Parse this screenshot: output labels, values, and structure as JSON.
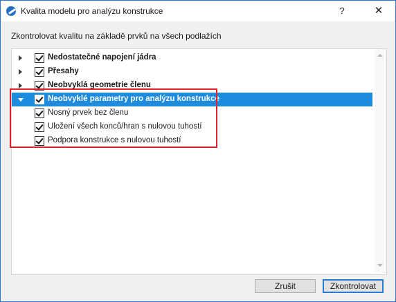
{
  "window": {
    "title": "Kvalita modelu pro analýzu konstrukce",
    "help_label": "?",
    "close_label": "✕"
  },
  "subtitle": "Zkontrolovat kvalitu na základě prvků na všech podlažích",
  "tree": {
    "items": [
      {
        "label": "Nedostatečné napojení jádra",
        "checked": true,
        "expanded": false,
        "bold": true
      },
      {
        "label": "Přesahy",
        "checked": true,
        "expanded": false,
        "bold": true
      },
      {
        "label": "Neobvyklá geometrie členu",
        "checked": true,
        "expanded": false,
        "bold": true
      },
      {
        "label": "Neobvyklé parametry pro analýzu konstrukce",
        "checked": true,
        "expanded": true,
        "bold": true,
        "selected": true
      },
      {
        "label": "Nosný prvek bez členu",
        "checked": true,
        "bold": false
      },
      {
        "label": "Uložení všech konců/hran s nulovou tuhostí",
        "checked": true,
        "bold": false
      },
      {
        "label": "Podpora konstrukce s nulovou tuhostí",
        "checked": true,
        "bold": false
      }
    ]
  },
  "buttons": {
    "cancel_label": "Zrušit",
    "check_label": "Zkontrolovat"
  },
  "colors": {
    "selection": "#1e8bdc",
    "highlight_border": "#e0202a",
    "window_border": "#2b79d6"
  }
}
